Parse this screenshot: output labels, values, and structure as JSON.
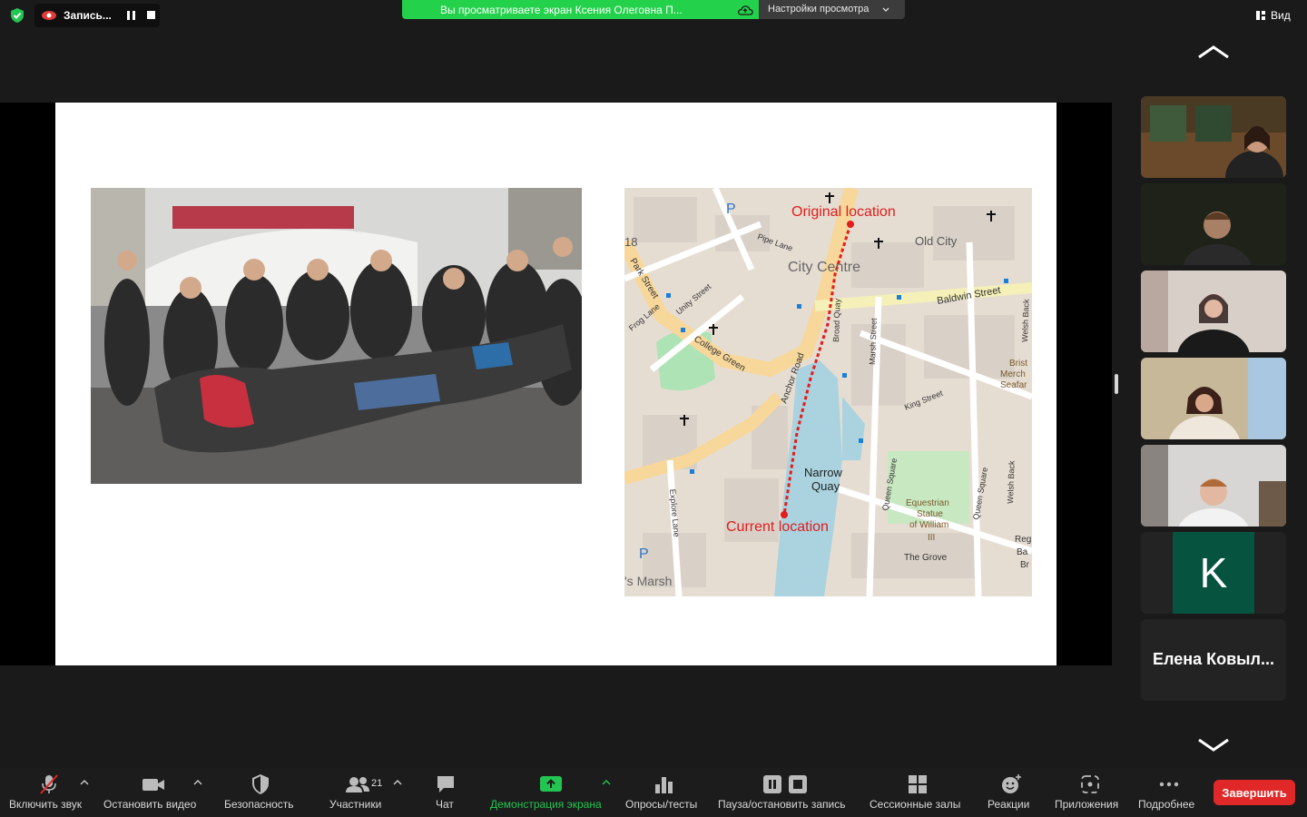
{
  "topbar": {
    "recording_label": "Запись...",
    "share_banner_text": "Вы просматриваете экран Ксения Олеговна П...",
    "view_settings_label": "Настройки просмотра",
    "view_label": "Вид"
  },
  "slide": {
    "photo_alt": "Statue toppling photo",
    "map": {
      "labels": {
        "original": "Original location",
        "current": "Current location",
        "old_city": "Old City",
        "city_centre": "City Centre",
        "baldwin_street": "Baldwin Street",
        "park_street": "Park Street",
        "unity_street": "Unity Street",
        "frog_lane": "Frog Lane",
        "college_green": "College Green",
        "anchor_road": "Anchor Road",
        "broad_quay": "Broad Quay",
        "marsh_street": "Marsh Street",
        "king_street": "King Street",
        "welsh_back": "Welsh Back",
        "narrow_quay": "Narrow Quay",
        "queen_square": "Queen Square",
        "equestrian": "Equestrian Statue of William III",
        "explore_lane": "Explore Lane",
        "the_grove": "The Grove",
        "pipe_lane": "Pipe Lane",
        "marsh": "'s Marsh",
        "bristol_merch": "Bristol Merch. Seafar",
        "reg": "Reg Ba Br",
        "num18": "18"
      }
    }
  },
  "participants": {
    "initial_tile_letter": "K",
    "name_tile_label": "Елена Ковыл..."
  },
  "toolbar": {
    "unmute": "Включить звук",
    "stop_video": "Остановить видео",
    "security": "Безопасность",
    "participants": "Участники",
    "participants_count": "21",
    "chat": "Чат",
    "share_screen": "Демонстрация экрана",
    "polls": "Опросы/тесты",
    "pause_recording": "Пауза/остановить запись",
    "breakout": "Сессионные залы",
    "reactions": "Реакции",
    "apps": "Приложения",
    "more": "Подробнее",
    "end": "Завершить"
  },
  "colors": {
    "share_green": "#23d14b",
    "end_red": "#e02828",
    "avatar_green": "#06543f",
    "route_red": "#e11d1d"
  }
}
